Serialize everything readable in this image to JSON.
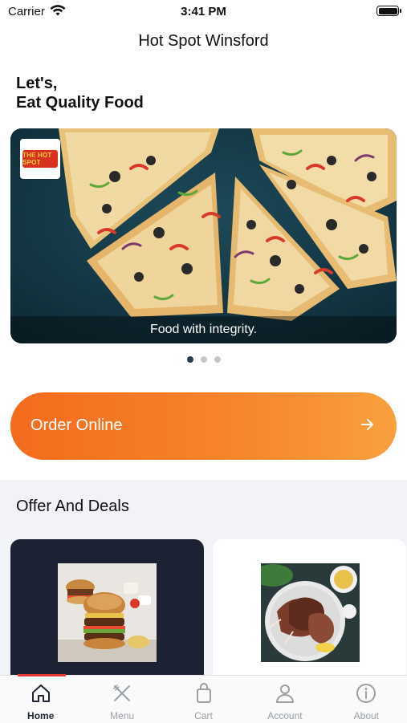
{
  "status_bar": {
    "carrier": "Carrier",
    "time": "3:41 PM"
  },
  "app": {
    "title": "Hot Spot Winsford"
  },
  "hero": {
    "line1": "Let's,",
    "line2": "Eat Quality Food"
  },
  "banner": {
    "caption": "Food with integrity.",
    "logo_text": "THE HOT SPOT",
    "slides": 3,
    "active_slide": 1
  },
  "order": {
    "label": "Order Online",
    "icon": "arrow-right-icon"
  },
  "offers": {
    "title": "Offer And Deals",
    "cards": [
      {
        "name": "burger-deal",
        "icon": "burger-photo"
      },
      {
        "name": "steak-deal",
        "icon": "steak-photo"
      }
    ]
  },
  "tabbar": {
    "items": [
      {
        "label": "Home",
        "icon": "home-icon",
        "active": true
      },
      {
        "label": "Menu",
        "icon": "cutlery-icon",
        "active": false
      },
      {
        "label": "Cart",
        "icon": "bag-icon",
        "active": false
      },
      {
        "label": "Account",
        "icon": "user-icon",
        "active": false
      },
      {
        "label": "About",
        "icon": "info-icon",
        "active": false
      }
    ]
  },
  "colors": {
    "accent": "#f36b1c",
    "tab_active": "#1e2634",
    "tab_inactive": "#9aa0a6",
    "offers_bg": "#f2f3f7"
  }
}
